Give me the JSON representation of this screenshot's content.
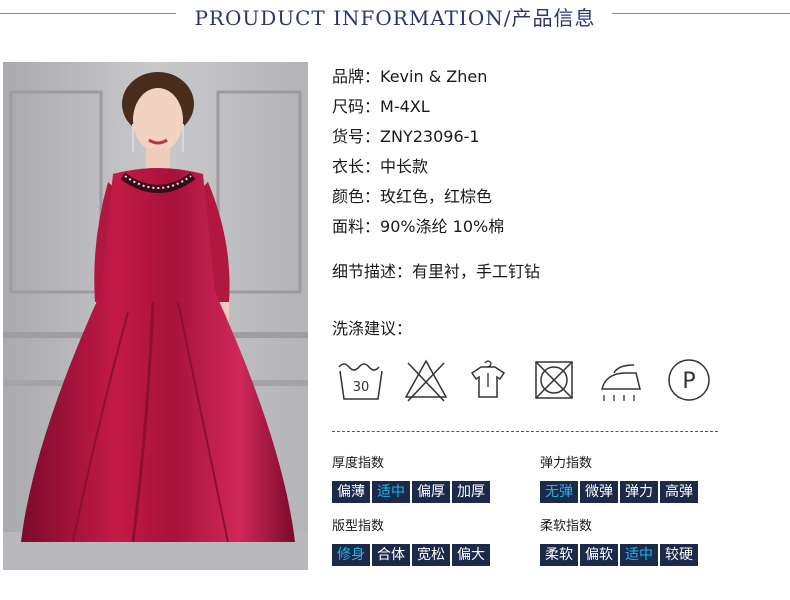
{
  "header": {
    "title": "PROUDUCT INFORMATION/产品信息"
  },
  "specs": [
    {
      "key": "品牌：",
      "value": "Kevin & Zhen"
    },
    {
      "key": "尺码：",
      "value": "M-4XL"
    },
    {
      "key": "货号：",
      "value": "ZNY23096-1"
    },
    {
      "key": "衣长：",
      "value": "中长款"
    },
    {
      "key": "颜色：",
      "value": "玫红色，红棕色"
    },
    {
      "key": "面料：",
      "value": "90%涤纶 10%棉"
    }
  ],
  "detail": {
    "key": "细节描述：",
    "value": "有里衬，手工钉钻"
  },
  "wash": {
    "title": "洗涤建议：",
    "icons": [
      "wash-30-icon",
      "no-bleach-icon",
      "hang-dry-icon",
      "no-tumble-dry-icon",
      "iron-steam-icon",
      "professional-dryclean-p-icon"
    ],
    "wash_temp": "30",
    "dryclean_letter": "P"
  },
  "indexes": {
    "thickness": {
      "label": "厚度指数",
      "options": [
        "偏薄",
        "适中",
        "偏厚",
        "加厚"
      ],
      "selected": "适中"
    },
    "elasticity": {
      "label": "弹力指数",
      "options": [
        "无弹",
        "微弹",
        "弹力",
        "高弹"
      ],
      "selected": "无弹"
    },
    "fit": {
      "label": "版型指数",
      "options": [
        "修身",
        "合体",
        "宽松",
        "偏大"
      ],
      "selected": "修身"
    },
    "softness": {
      "label": "柔软指数",
      "options": [
        "柔软",
        "偏软",
        "适中",
        "较硬"
      ],
      "selected": "适中"
    }
  },
  "colors": {
    "accent": "#1fb6e8",
    "chip_bg": "#1b2a4a",
    "header_text": "#2c3570",
    "dress": "#b3153f"
  }
}
